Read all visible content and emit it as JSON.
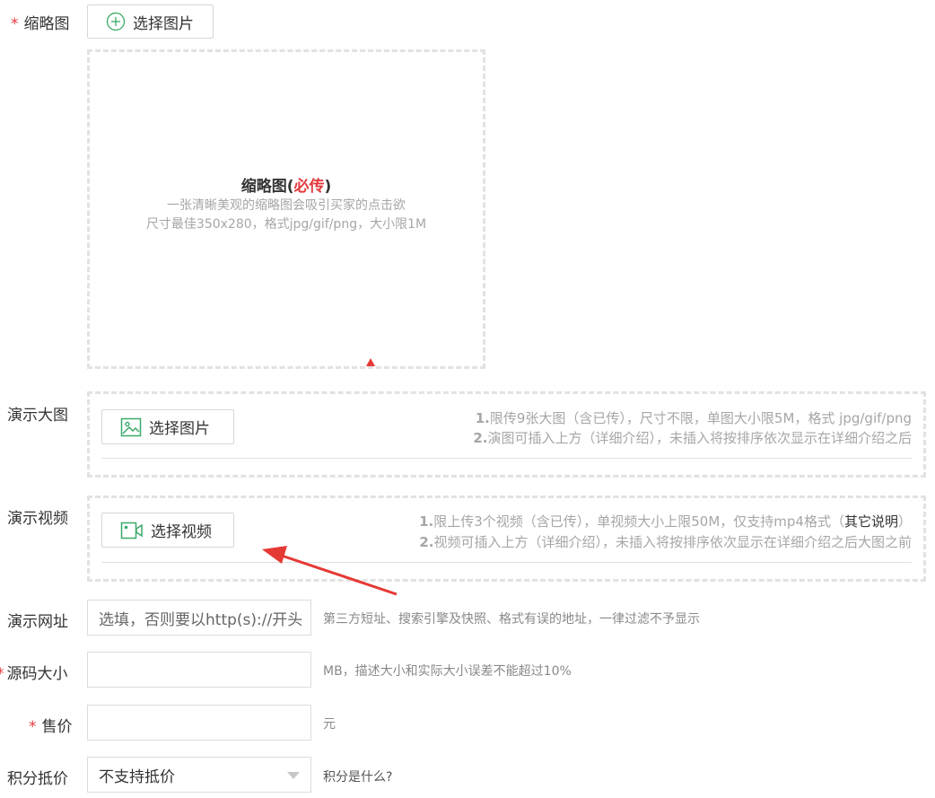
{
  "thumbnail": {
    "label": "缩略图",
    "required_mark": "*",
    "button_label": "选择图片",
    "preview_title": "缩略图",
    "preview_paren_open": "(",
    "preview_required": "必传",
    "preview_paren_close": ")",
    "preview_desc1": "一张清晰美观的缩略图会吸引买家的点击欲",
    "preview_desc2": "尺寸最佳350x280，格式jpg/gif/png，大小限1M"
  },
  "demo_images": {
    "label": "演示大图",
    "button_label": "选择图片",
    "tip1_num": "1.",
    "tip1_text": "限传9张大图（含已传），尺寸不限，单图大小限5M，格式 jpg/gif/png",
    "tip2_num": "2.",
    "tip2_text": "演图可插入上方（详细介绍），未插入将按排序依次显示在详细介绍之后"
  },
  "demo_video": {
    "label": "演示视频",
    "button_label": "选择视频",
    "tip1_num": "1.",
    "tip1_text": "限上传3个视频（含已传），单视频大小上限50M，仅支持mp4格式（",
    "tip1_link": "其它说明",
    "tip1_end": "）",
    "tip2_num": "2.",
    "tip2_text": "视频可插入上方（详细介绍），未插入将按排序依次显示在详细介绍之后大图之前"
  },
  "demo_url": {
    "label": "演示网址",
    "placeholder": "选填，否则要以http(s)://开头",
    "hint": "第三方短址、搜索引擎及快照、格式有误的地址，一律过滤不予显示"
  },
  "source_size": {
    "label": "源码大小",
    "required_mark": "*",
    "value": "",
    "hint": "MB，描述大小和实际大小误差不能超过10%"
  },
  "price": {
    "label": "售价",
    "required_mark": "*",
    "value": "",
    "unit": "元"
  },
  "points": {
    "label": "积分抵价",
    "selected": "不支持抵价",
    "help_link": "积分是什么?"
  },
  "colors": {
    "required": "#e4393c",
    "icon_green": "#3aaa6a",
    "arrow_red": "#e53935"
  }
}
